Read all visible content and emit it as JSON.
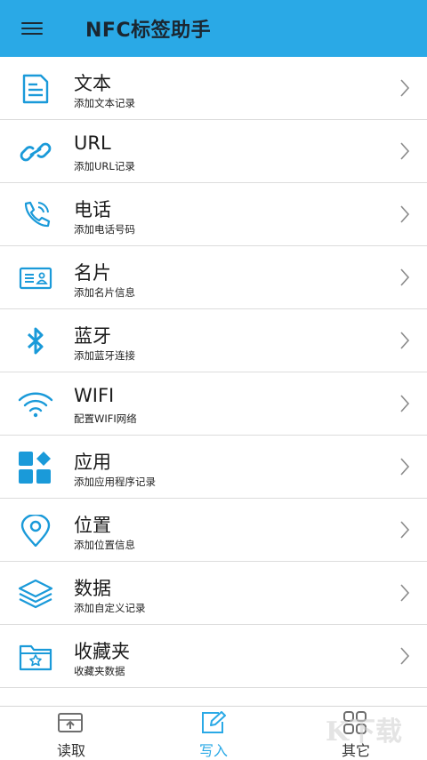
{
  "appbar": {
    "title": "NFC标签助手",
    "menu_icon": "menu-icon",
    "color": "#2aa9e6"
  },
  "items": [
    {
      "title": "文本",
      "subtitle": "添加文本记录",
      "icon": "document-icon"
    },
    {
      "title": "URL",
      "subtitle": "添加URL记录",
      "icon": "link-icon"
    },
    {
      "title": "电话",
      "subtitle": "添加电话号码",
      "icon": "phone-icon"
    },
    {
      "title": "名片",
      "subtitle": "添加名片信息",
      "icon": "business-card-icon"
    },
    {
      "title": "蓝牙",
      "subtitle": "添加蓝牙连接",
      "icon": "bluetooth-icon"
    },
    {
      "title": "WIFI",
      "subtitle": "配置WIFI网络",
      "icon": "wifi-icon"
    },
    {
      "title": "应用",
      "subtitle": "添加应用程序记录",
      "icon": "apps-icon"
    },
    {
      "title": "位置",
      "subtitle": "添加位置信息",
      "icon": "location-pin-icon"
    },
    {
      "title": "数据",
      "subtitle": "添加自定义记录",
      "icon": "layers-icon"
    },
    {
      "title": "收藏夹",
      "subtitle": "收藏夹数据",
      "icon": "folder-star-icon"
    }
  ],
  "tabs": [
    {
      "label": "读取",
      "icon": "read-icon",
      "active": false
    },
    {
      "label": "写入",
      "icon": "write-icon",
      "active": true
    },
    {
      "label": "其它",
      "icon": "grid-icon",
      "active": false
    }
  ],
  "watermark": "K下载",
  "colors": {
    "accent": "#2aa9e6",
    "icon": "#1a9ad9",
    "divider": "#dcdcdc"
  }
}
